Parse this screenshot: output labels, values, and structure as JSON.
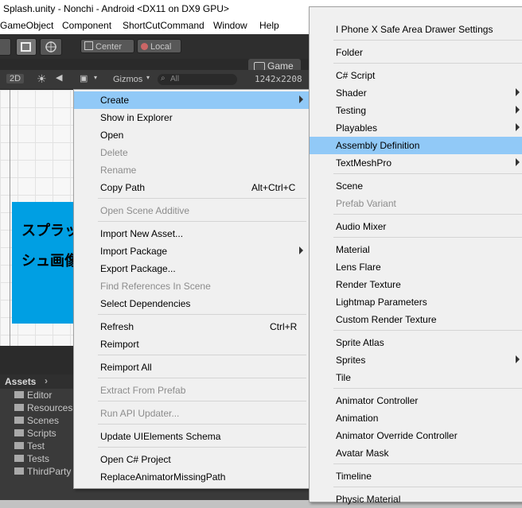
{
  "window": {
    "title": "Splash.unity - Nonchi - Android <DX11 on DX9 GPU>"
  },
  "menubar": {
    "items": [
      "GameObject",
      "Component",
      "ShortCutCommand",
      "Window",
      "Help"
    ]
  },
  "toolbar": {
    "center_label": "Center",
    "local_label": "Local"
  },
  "scene_toolbar": {
    "mode_2d": "2D",
    "gizmos_label": "Gizmos",
    "search_placeholder": "All"
  },
  "game_tab": {
    "label": "Game",
    "resolution": "1242x2208"
  },
  "scene": {
    "text_line1": "スプラッ",
    "text_line2": "シュ画像"
  },
  "project": {
    "assets_label": "Assets",
    "folders": [
      "Editor",
      "Resources",
      "Scenes",
      "Scripts",
      "Test",
      "Tests",
      "ThirdParty"
    ]
  },
  "context_menu": {
    "items": [
      {
        "label": "Create",
        "shortcut": "",
        "disabled": false,
        "submenu": true,
        "highlighted": true
      },
      {
        "label": "Show in Explorer",
        "shortcut": "",
        "disabled": false
      },
      {
        "label": "Open",
        "shortcut": "",
        "disabled": false
      },
      {
        "label": "Delete",
        "shortcut": "",
        "disabled": true
      },
      {
        "label": "Rename",
        "shortcut": "",
        "disabled": true
      },
      {
        "label": "Copy Path",
        "shortcut": "Alt+Ctrl+C",
        "disabled": false
      },
      {
        "label": "Open Scene Additive",
        "shortcut": "",
        "disabled": true
      },
      {
        "label": "Import New Asset...",
        "shortcut": "",
        "disabled": false
      },
      {
        "label": "Import Package",
        "shortcut": "",
        "disabled": false,
        "submenu": true
      },
      {
        "label": "Export Package...",
        "shortcut": "",
        "disabled": false
      },
      {
        "label": "Find References In Scene",
        "shortcut": "",
        "disabled": true
      },
      {
        "label": "Select Dependencies",
        "shortcut": "",
        "disabled": false
      },
      {
        "label": "Refresh",
        "shortcut": "Ctrl+R",
        "disabled": false
      },
      {
        "label": "Reimport",
        "shortcut": "",
        "disabled": false
      },
      {
        "label": "Reimport All",
        "shortcut": "",
        "disabled": false
      },
      {
        "label": "Extract From Prefab",
        "shortcut": "",
        "disabled": true
      },
      {
        "label": "Run API Updater...",
        "shortcut": "",
        "disabled": true
      },
      {
        "label": "Update UIElements Schema",
        "shortcut": "",
        "disabled": false
      },
      {
        "label": "Open C# Project",
        "shortcut": "",
        "disabled": false
      },
      {
        "label": "ReplaceAnimatorMissingPath",
        "shortcut": "",
        "disabled": false
      }
    ]
  },
  "create_submenu": {
    "items": [
      {
        "label": "I Phone X Safe Area Drawer Settings",
        "disabled": false
      },
      {
        "label": "Folder",
        "disabled": false
      },
      {
        "label": "C# Script",
        "disabled": false
      },
      {
        "label": "Shader",
        "disabled": false,
        "submenu": true
      },
      {
        "label": "Testing",
        "disabled": false,
        "submenu": true
      },
      {
        "label": "Playables",
        "disabled": false,
        "submenu": true
      },
      {
        "label": "Assembly Definition",
        "disabled": false,
        "highlighted": true
      },
      {
        "label": "TextMeshPro",
        "disabled": false,
        "submenu": true
      },
      {
        "label": "Scene",
        "disabled": false
      },
      {
        "label": "Prefab Variant",
        "disabled": true
      },
      {
        "label": "Audio Mixer",
        "disabled": false
      },
      {
        "label": "Material",
        "disabled": false
      },
      {
        "label": "Lens Flare",
        "disabled": false
      },
      {
        "label": "Render Texture",
        "disabled": false
      },
      {
        "label": "Lightmap Parameters",
        "disabled": false
      },
      {
        "label": "Custom Render Texture",
        "disabled": false
      },
      {
        "label": "Sprite Atlas",
        "disabled": false
      },
      {
        "label": "Sprites",
        "disabled": false,
        "submenu": true
      },
      {
        "label": "Tile",
        "disabled": false
      },
      {
        "label": "Animator Controller",
        "disabled": false
      },
      {
        "label": "Animation",
        "disabled": false
      },
      {
        "label": "Animator Override Controller",
        "disabled": false
      },
      {
        "label": "Avatar Mask",
        "disabled": false
      },
      {
        "label": "Timeline",
        "disabled": false
      },
      {
        "label": "Physic Material",
        "disabled": false
      }
    ]
  },
  "colors": {
    "highlight": "#91c9f7",
    "menu_bg": "#f0f0f0",
    "disabled_text": "#8c8c8c",
    "scene_panel": "#009fe3"
  }
}
